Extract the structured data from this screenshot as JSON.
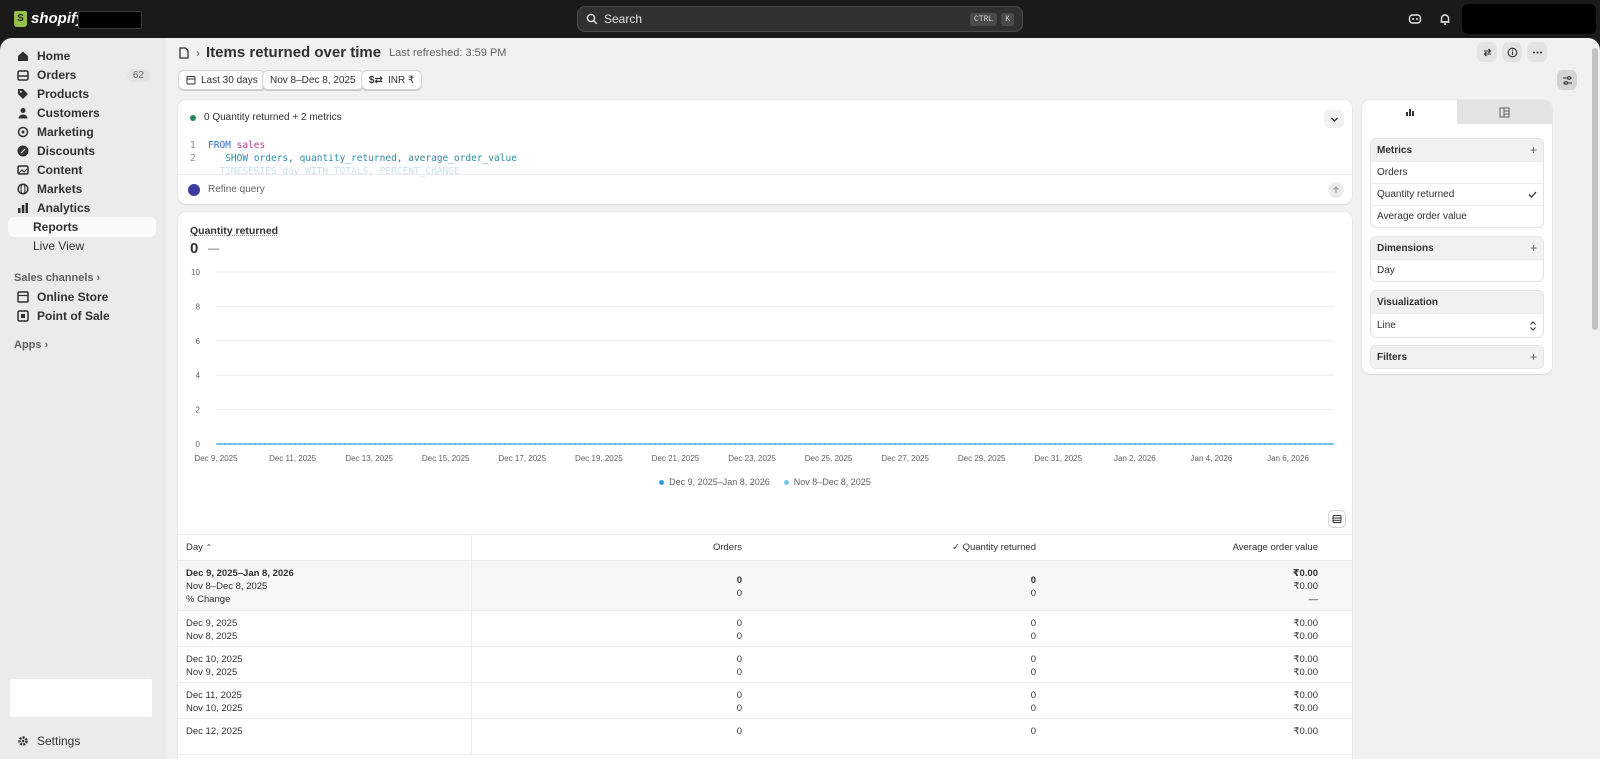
{
  "topbar": {
    "brand": "shopify",
    "search_label": "Search",
    "shortcut_ctrl": "CTRL",
    "shortcut_k": "K"
  },
  "sidebar": {
    "items": [
      {
        "label": "Home",
        "icon": "home-icon"
      },
      {
        "label": "Orders",
        "icon": "orders-icon",
        "badge": "62"
      },
      {
        "label": "Products",
        "icon": "tag-icon"
      },
      {
        "label": "Customers",
        "icon": "person-icon"
      },
      {
        "label": "Marketing",
        "icon": "target-icon"
      },
      {
        "label": "Discounts",
        "icon": "discount-icon"
      },
      {
        "label": "Content",
        "icon": "image-icon"
      },
      {
        "label": "Markets",
        "icon": "globe-icon"
      },
      {
        "label": "Analytics",
        "icon": "bar-chart-icon"
      },
      {
        "label": "Reports"
      },
      {
        "label": "Live View"
      }
    ],
    "sales_channels": "Sales channels",
    "channels": [
      {
        "label": "Online Store",
        "icon": "store-icon"
      },
      {
        "label": "Point of Sale",
        "icon": "pos-icon"
      }
    ],
    "apps": "Apps",
    "settings": "Settings"
  },
  "header": {
    "title": "Items returned over time",
    "refreshed": "Last refreshed: 3:59 PM"
  },
  "filters": {
    "range": "Last 30 days",
    "compare": "Nov 8–Dec 8, 2025",
    "currency": "INR ₹"
  },
  "query": {
    "summary": "0 Quantity returned + 2 metrics",
    "line1_no": "1",
    "line2_no": "2",
    "line1_kw": "FROM",
    "line1_tbl": "sales",
    "line2_kw": "SHOW",
    "line2_fields": "orders, quantity_returned, average_order_value",
    "line3": "TIMESERIES day WITH TOTALS, PERCENT_CHANGE",
    "refine": "Refine query"
  },
  "chart": {
    "metric_label": "Quantity returned",
    "metric_value": "0",
    "metric_change": "—",
    "legend": [
      "Dec 9, 2025–Jan 8, 2026",
      "Nov 8–Dec 8, 2025"
    ],
    "colors": {
      "primary": "#2a9fd8",
      "comparison": "#7cc6ea"
    }
  },
  "chart_data": {
    "type": "line",
    "x": [
      "Dec 9, 2025",
      "Dec 11, 2025",
      "Dec 13, 2025",
      "Dec 15, 2025",
      "Dec 17, 2025",
      "Dec 19, 2025",
      "Dec 21, 2025",
      "Dec 23, 2025",
      "Dec 25, 2025",
      "Dec 27, 2025",
      "Dec 29, 2025",
      "Dec 31, 2025",
      "Jan 2, 2026",
      "Jan 4, 2026",
      "Jan 6, 2026"
    ],
    "series": [
      {
        "name": "Dec 9, 2025–Jan 8, 2026",
        "values": [
          0,
          0,
          0,
          0,
          0,
          0,
          0,
          0,
          0,
          0,
          0,
          0,
          0,
          0,
          0
        ]
      },
      {
        "name": "Nov 8–Dec 8, 2025",
        "values": [
          0,
          0,
          0,
          0,
          0,
          0,
          0,
          0,
          0,
          0,
          0,
          0,
          0,
          0,
          0
        ]
      }
    ],
    "yticks": [
      "0",
      "2",
      "4",
      "6",
      "8",
      "10"
    ],
    "ylim": [
      0,
      10
    ],
    "grid": true,
    "legend_position": "bottom"
  },
  "table": {
    "headers": {
      "day": "Day",
      "orders": "Orders",
      "qty": "Quantity returned",
      "aov": "Average order value"
    },
    "total": {
      "day1": "Dec 9, 2025–Jan 8, 2026",
      "day2": "Nov 8–Dec 8, 2025",
      "day3": "% Change",
      "orders1": "0",
      "orders2": "0",
      "qty1": "0",
      "qty2": "0",
      "aov1": "₹0.00",
      "aov2": "₹0.00",
      "aov3": "—"
    },
    "rows": [
      {
        "d1": "Dec 9, 2025",
        "d2": "Nov 8, 2025",
        "o1": "0",
        "o2": "0",
        "q1": "0",
        "q2": "0",
        "a1": "₹0.00",
        "a2": "₹0.00"
      },
      {
        "d1": "Dec 10, 2025",
        "d2": "Nov 9, 2025",
        "o1": "0",
        "o2": "0",
        "q1": "0",
        "q2": "0",
        "a1": "₹0.00",
        "a2": "₹0.00"
      },
      {
        "d1": "Dec 11, 2025",
        "d2": "Nov 10, 2025",
        "o1": "0",
        "o2": "0",
        "q1": "0",
        "q2": "0",
        "a1": "₹0.00",
        "a2": "₹0.00"
      },
      {
        "d1": "Dec 12, 2025",
        "d2": "",
        "o1": "0",
        "o2": "",
        "q1": "0",
        "q2": "",
        "a1": "₹0.00",
        "a2": ""
      }
    ]
  },
  "panel": {
    "metrics_title": "Metrics",
    "metrics": [
      "Orders",
      "Quantity returned",
      "Average order value"
    ],
    "dimensions_title": "Dimensions",
    "dimension": "Day",
    "visualization_title": "Visualization",
    "visualization": "Line",
    "filters_title": "Filters"
  }
}
